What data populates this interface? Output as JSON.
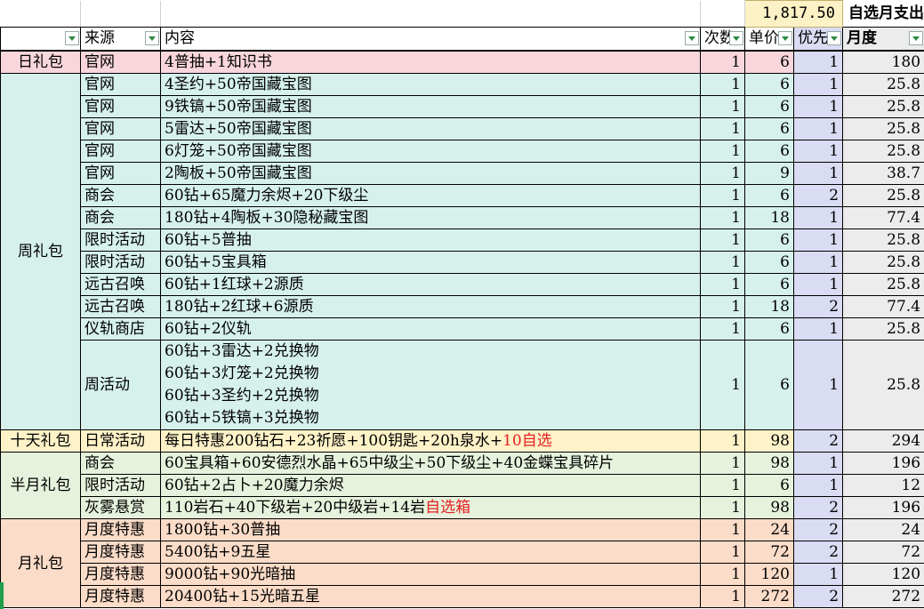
{
  "top": {
    "total": "1,817.50",
    "title": "自选月支出"
  },
  "headers": {
    "category": "",
    "source": "来源",
    "content": "内容",
    "times": "次数",
    "unit_price": "单价",
    "priority": "优先",
    "monthly": "月度"
  },
  "groups": [
    {
      "category": "日礼包",
      "rows": [
        {
          "source": "官网",
          "content": "4普抽+1知识书",
          "times": "1",
          "price": "6",
          "priority": "1",
          "monthly": "180"
        }
      ]
    },
    {
      "category": "周礼包",
      "rows": [
        {
          "source": "官网",
          "content": "4圣约+50帝国藏宝图",
          "times": "1",
          "price": "6",
          "priority": "1",
          "monthly": "25.8"
        },
        {
          "source": "官网",
          "content": "9铁镐+50帝国藏宝图",
          "times": "1",
          "price": "6",
          "priority": "1",
          "monthly": "25.8"
        },
        {
          "source": "官网",
          "content": "5雷达+50帝国藏宝图",
          "times": "1",
          "price": "6",
          "priority": "1",
          "monthly": "25.8"
        },
        {
          "source": "官网",
          "content": "6灯笼+50帝国藏宝图",
          "times": "1",
          "price": "6",
          "priority": "1",
          "monthly": "25.8"
        },
        {
          "source": "官网",
          "content": "2陶板+50帝国藏宝图",
          "times": "1",
          "price": "9",
          "priority": "1",
          "monthly": "38.7"
        },
        {
          "source": "商会",
          "content": "60钻+65魔力余烬+20下级尘",
          "times": "1",
          "price": "6",
          "priority": "2",
          "monthly": "25.8"
        },
        {
          "source": "商会",
          "content": "180钻+4陶板+30隐秘藏宝图",
          "times": "1",
          "price": "18",
          "priority": "1",
          "monthly": "77.4"
        },
        {
          "source": "限时活动",
          "content": "60钻+5普抽",
          "times": "1",
          "price": "6",
          "priority": "1",
          "monthly": "25.8"
        },
        {
          "source": "限时活动",
          "content": "60钻+5宝具箱",
          "times": "1",
          "price": "6",
          "priority": "1",
          "monthly": "25.8"
        },
        {
          "source": "远古召唤",
          "content": "60钻+1红球+2源质",
          "times": "1",
          "price": "6",
          "priority": "1",
          "monthly": "25.8"
        },
        {
          "source": "远古召唤",
          "content": "180钻+2红球+6源质",
          "times": "1",
          "price": "18",
          "priority": "2",
          "monthly": "77.4"
        },
        {
          "source": "仪轨商店",
          "content": "60钻+2仪轨",
          "times": "1",
          "price": "6",
          "priority": "1",
          "monthly": "25.8"
        }
      ]
    },
    {
      "category": "",
      "multi": {
        "source": "周活动",
        "lines": [
          "60钻+3雷达+2兑换物",
          "60钻+3灯笼+2兑换物",
          "60钻+3圣约+2兑换物",
          "60钻+5铁镐+3兑换物"
        ],
        "times": "1",
        "price": "6",
        "priority": "1",
        "monthly": "25.8"
      }
    },
    {
      "category": "十天礼包",
      "rows": [
        {
          "source": "日常活动",
          "content": "每日特惠200钻石+23祈愿+100钥匙+20h泉水+",
          "content_red": "10自选",
          "times": "1",
          "price": "98",
          "priority": "2",
          "monthly": "294"
        }
      ]
    },
    {
      "category": "半月礼包",
      "rows": [
        {
          "source": "商会",
          "content": "60宝具箱+60安德烈水晶+65中级尘+50下级尘+40金蝶宝具碎片",
          "times": "1",
          "price": "98",
          "priority": "1",
          "monthly": "196"
        },
        {
          "source": "限时活动",
          "content": "60钻+2占卜+20魔力余烬",
          "times": "1",
          "price": "6",
          "priority": "1",
          "monthly": "12"
        },
        {
          "source": "灰雾悬赏",
          "content": "110岩石+40下级岩+20中级岩+14岩",
          "content_red": "自选箱",
          "times": "1",
          "price": "98",
          "priority": "2",
          "monthly": "196"
        }
      ]
    },
    {
      "category": "月礼包",
      "rows": [
        {
          "source": "月度特惠",
          "content": "1800钻+30普抽",
          "times": "1",
          "price": "24",
          "priority": "2",
          "monthly": "24"
        },
        {
          "source": "月度特惠",
          "content": "5400钻+9五星",
          "times": "1",
          "price": "72",
          "priority": "2",
          "monthly": "72"
        },
        {
          "source": "月度特惠",
          "content": "9000钻+90光暗抽",
          "times": "1",
          "price": "120",
          "priority": "1",
          "monthly": "120"
        },
        {
          "source": "月度特惠",
          "content": "20400钻+15光暗五星",
          "times": "1",
          "price": "272",
          "priority": "2",
          "monthly": "272"
        }
      ]
    }
  ]
}
